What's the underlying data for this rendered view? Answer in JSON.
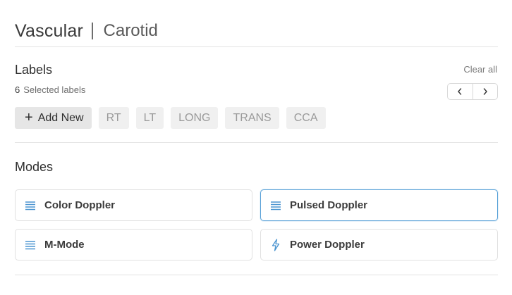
{
  "header": {
    "app": "Vascular",
    "section": "Carotid"
  },
  "labels": {
    "title": "Labels",
    "clear_all": "Clear all",
    "selected_count": "6",
    "selected_text": "Selected labels",
    "add_new": "Add New",
    "chips": [
      "RT",
      "LT",
      "LONG",
      "TRANS",
      "CCA"
    ]
  },
  "modes": {
    "title": "Modes",
    "items": [
      {
        "label": "Color Doppler",
        "icon": "lines-icon",
        "selected": false
      },
      {
        "label": "Pulsed Doppler",
        "icon": "lines-icon",
        "selected": true
      },
      {
        "label": "M-Mode",
        "icon": "lines-icon",
        "selected": false
      },
      {
        "label": "Power Doppler",
        "icon": "lightning-icon",
        "selected": false
      }
    ]
  },
  "colors": {
    "accent": "#5aa2d8",
    "icon_blue": "#4a94d0"
  }
}
